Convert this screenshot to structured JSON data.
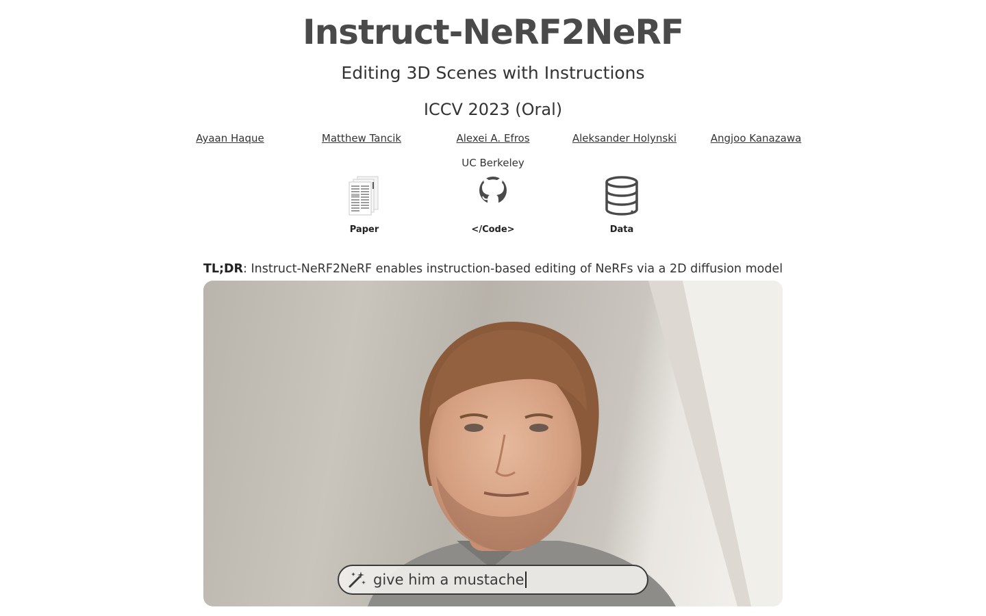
{
  "header": {
    "title": "Instruct-NeRF2NeRF",
    "subtitle": "Editing 3D Scenes with Instructions",
    "venue": "ICCV 2023 (Oral)"
  },
  "authors": [
    {
      "name": "Ayaan Haque"
    },
    {
      "name": "Matthew Tancik"
    },
    {
      "name": "Alexei A. Efros"
    },
    {
      "name": "Aleksander Holynski"
    },
    {
      "name": "Angjoo Kanazawa"
    }
  ],
  "affiliation": "UC Berkeley",
  "links": [
    {
      "label": "Paper",
      "icon": "paper-icon"
    },
    {
      "label": "</Code>",
      "icon": "github-icon"
    },
    {
      "label": "Data",
      "icon": "database-icon"
    }
  ],
  "tldr": {
    "lead": "TL;DR",
    "text": ": Instruct-NeRF2NeRF enables instruction-based editing of NeRFs via a 2D diffusion model"
  },
  "video": {
    "prompt": "give him a mustache",
    "prompt_icon": "magic-wand-icon"
  }
}
